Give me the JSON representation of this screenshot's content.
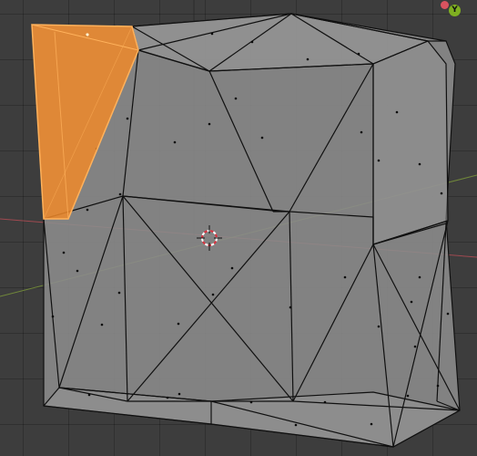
{
  "viewport": {
    "background": "#3d3d3d",
    "grid_color": "#2e2e2e",
    "x_axis_color": "#b84d55",
    "y_axis_color": "#7d9a3a",
    "mesh_face_color": "#8c8c8c",
    "mesh_edge_color": "#101010",
    "selected_face_color": "#f08a2a",
    "selected_edge_color": "#ffb25c"
  },
  "gizmo": {
    "x_axis": {
      "label": "",
      "color": "#d9535f"
    },
    "y_axis": {
      "label": "Y",
      "color": "#7fb021"
    }
  },
  "cursor_3d": {
    "icon": "3d-cursor-icon",
    "color_a": "#d9323f",
    "color_b": "#ffffff"
  }
}
